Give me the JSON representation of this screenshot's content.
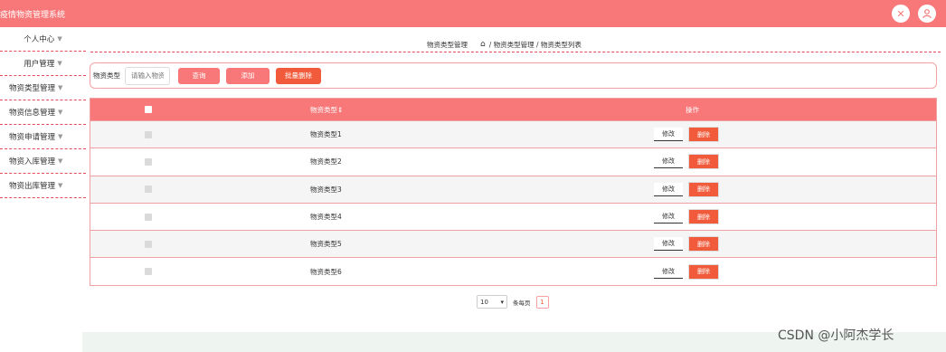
{
  "app": {
    "title": "疫情物资管理系统"
  },
  "header": {
    "fullscreen_icon": "fullscreen-exit-icon",
    "user_icon": "user-icon"
  },
  "sidebar": {
    "items": [
      {
        "label": "个人中心"
      },
      {
        "label": "用户管理"
      },
      {
        "label": "物资类型管理"
      },
      {
        "label": "物资信息管理"
      },
      {
        "label": "物资申请管理"
      },
      {
        "label": "物资入库管理"
      },
      {
        "label": "物资出库管理"
      }
    ]
  },
  "breadcrumb": {
    "section": "物资类型管理",
    "home_icon": "home-icon",
    "path": "/ 物资类型管理 / 物资类型列表"
  },
  "search": {
    "label": "物资类型",
    "placeholder": "请输入物资",
    "query_label": "查询",
    "add_label": "添加",
    "batch_delete_label": "批量删除"
  },
  "table": {
    "columns": [
      "物资类型⇕",
      "操作"
    ],
    "edit_label": "修改",
    "delete_label": "删除",
    "rows": [
      {
        "name": "物资类型1"
      },
      {
        "name": "物资类型2"
      },
      {
        "name": "物资类型3"
      },
      {
        "name": "物资类型4"
      },
      {
        "name": "物资类型5"
      },
      {
        "name": "物资类型6"
      }
    ]
  },
  "pagination": {
    "page_size": "10",
    "per_page_label": "条每页",
    "current_page": "1"
  },
  "watermark": "CSDN @小阿杰学长",
  "colors": {
    "primary": "#f87879",
    "danger": "#f15a3a",
    "dash": "#e44b5a"
  }
}
